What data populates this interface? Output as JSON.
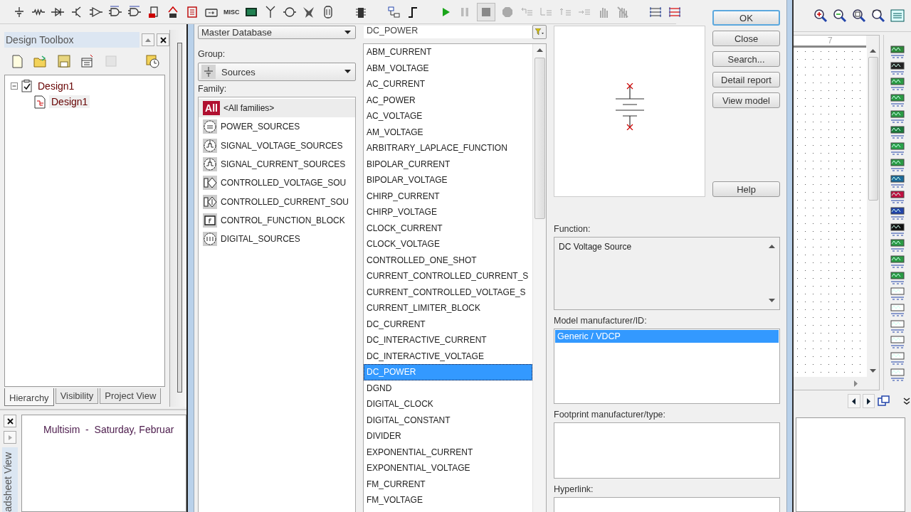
{
  "toolbar": {
    "misc_label": "MISC"
  },
  "design_toolbox": {
    "title": "Design Toolbox",
    "tree": [
      {
        "label": "Design1",
        "checked": true,
        "expanded": true,
        "children": [
          {
            "label": "Design1",
            "selected": true
          }
        ]
      }
    ],
    "tabs": [
      {
        "label": "Hierarchy",
        "selected": true
      },
      {
        "label": "Visibility",
        "selected": false
      },
      {
        "label": "Project View",
        "selected": false
      }
    ]
  },
  "spreadsheet": {
    "tab_label": "adsheet View",
    "log_text": "Multisim  -  Saturday, Februar"
  },
  "dialog": {
    "database": "Master Database",
    "group_label": "Group:",
    "group": "Sources",
    "family_label": "Family:",
    "families": [
      {
        "label": "<All families>",
        "badge": "All",
        "selected": true
      },
      {
        "label": "POWER_SOURCES",
        "selected": false
      },
      {
        "label": "SIGNAL_VOLTAGE_SOURCES",
        "selected": false
      },
      {
        "label": "SIGNAL_CURRENT_SOURCES",
        "selected": false
      },
      {
        "label": "CONTROLLED_VOLTAGE_SOU",
        "selected": false
      },
      {
        "label": "CONTROLLED_CURRENT_SOU",
        "selected": false
      },
      {
        "label": "CONTROL_FUNCTION_BLOCK",
        "selected": false
      },
      {
        "label": "DIGITAL_SOURCES",
        "selected": false
      }
    ],
    "component_search": "DC_POWER",
    "components": [
      {
        "label": "ABM_CURRENT",
        "selected": false
      },
      {
        "label": "ABM_VOLTAGE",
        "selected": false
      },
      {
        "label": "AC_CURRENT",
        "selected": false
      },
      {
        "label": "AC_POWER",
        "selected": false
      },
      {
        "label": "AC_VOLTAGE",
        "selected": false
      },
      {
        "label": "AM_VOLTAGE",
        "selected": false
      },
      {
        "label": "ARBITRARY_LAPLACE_FUNCTION",
        "selected": false
      },
      {
        "label": "BIPOLAR_CURRENT",
        "selected": false
      },
      {
        "label": "BIPOLAR_VOLTAGE",
        "selected": false
      },
      {
        "label": "CHIRP_CURRENT",
        "selected": false
      },
      {
        "label": "CHIRP_VOLTAGE",
        "selected": false
      },
      {
        "label": "CLOCK_CURRENT",
        "selected": false
      },
      {
        "label": "CLOCK_VOLTAGE",
        "selected": false
      },
      {
        "label": "CONTROLLED_ONE_SHOT",
        "selected": false
      },
      {
        "label": "CURRENT_CONTROLLED_CURRENT_S",
        "selected": false
      },
      {
        "label": "CURRENT_CONTROLLED_VOLTAGE_S",
        "selected": false
      },
      {
        "label": "CURRENT_LIMITER_BLOCK",
        "selected": false
      },
      {
        "label": "DC_CURRENT",
        "selected": false
      },
      {
        "label": "DC_INTERACTIVE_CURRENT",
        "selected": false
      },
      {
        "label": "DC_INTERACTIVE_VOLTAGE",
        "selected": false
      },
      {
        "label": "DC_POWER",
        "selected": true
      },
      {
        "label": "DGND",
        "selected": false
      },
      {
        "label": "DIGITAL_CLOCK",
        "selected": false
      },
      {
        "label": "DIGITAL_CONSTANT",
        "selected": false
      },
      {
        "label": "DIVIDER",
        "selected": false
      },
      {
        "label": "EXPONENTIAL_CURRENT",
        "selected": false
      },
      {
        "label": "EXPONENTIAL_VOLTAGE",
        "selected": false
      },
      {
        "label": "FM_CURRENT",
        "selected": false
      },
      {
        "label": "FM_VOLTAGE",
        "selected": false
      }
    ],
    "function_label": "Function:",
    "function_text": "DC Voltage Source",
    "model_label": "Model manufacturer/ID:",
    "models": [
      {
        "label": "Generic / VDCP",
        "selected": true
      }
    ],
    "footprint_label": "Footprint manufacturer/type:",
    "hyperlink_label": "Hyperlink:",
    "buttons": [
      {
        "label": "OK",
        "default": true
      },
      {
        "label": "Close",
        "default": false
      },
      {
        "label": "Search...",
        "default": false
      },
      {
        "label": "Detail report",
        "default": false
      },
      {
        "label": "View model",
        "default": false
      }
    ],
    "help_button": "Help"
  },
  "right_pane": {
    "ruler_mark": "7"
  }
}
